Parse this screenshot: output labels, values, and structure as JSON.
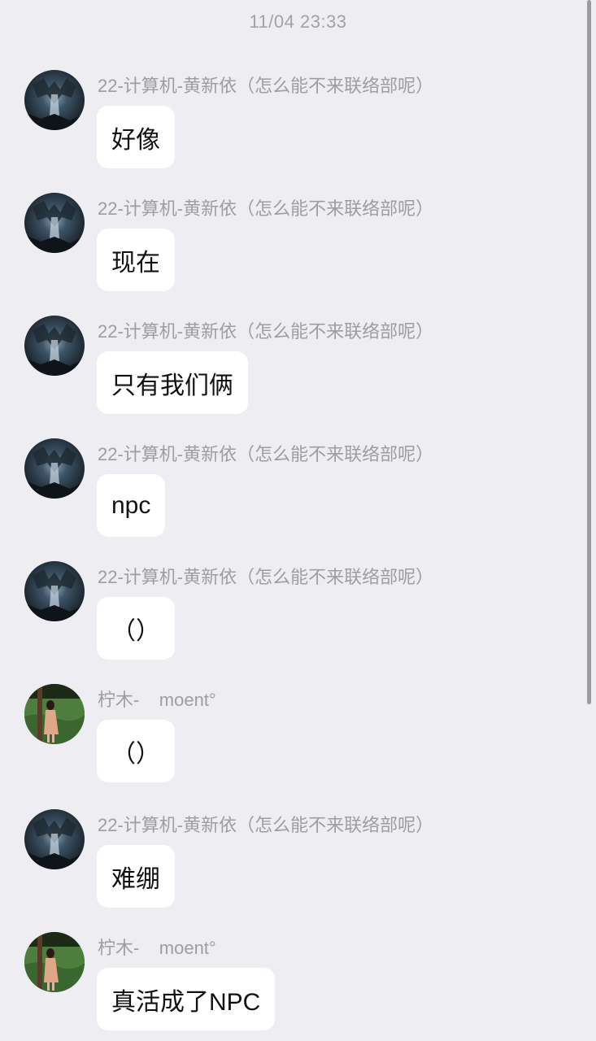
{
  "timestamp": "11/04 23:33",
  "messages": [
    {
      "sender": "22-计算机-黄新依（怎么能不来联络部呢）",
      "text": "好像",
      "avatar": "dark-cave-avatar"
    },
    {
      "sender": "22-计算机-黄新依（怎么能不来联络部呢）",
      "text": "现在",
      "avatar": "dark-cave-avatar"
    },
    {
      "sender": "22-计算机-黄新依（怎么能不来联络部呢）",
      "text": "只有我们俩",
      "avatar": "dark-cave-avatar"
    },
    {
      "sender": "22-计算机-黄新依（怎么能不来联络部呢）",
      "text": "npc",
      "avatar": "dark-cave-avatar"
    },
    {
      "sender": "22-计算机-黄新依（怎么能不来联络部呢）",
      "text": "（）",
      "avatar": "dark-cave-avatar"
    },
    {
      "sender": "柠木-    moent°",
      "text": "（）",
      "avatar": "green-field-girl-avatar"
    },
    {
      "sender": "22-计算机-黄新依（怎么能不来联络部呢）",
      "text": "难绷",
      "avatar": "dark-cave-avatar"
    },
    {
      "sender": "柠木-    moent°",
      "text": "真活成了NPC",
      "avatar": "green-field-girl-avatar"
    }
  ],
  "colors": {
    "background": "#EEEDF2",
    "bubble": "#FFFFFF",
    "sender_text": "#9E9DA3",
    "message_text": "#111111"
  }
}
